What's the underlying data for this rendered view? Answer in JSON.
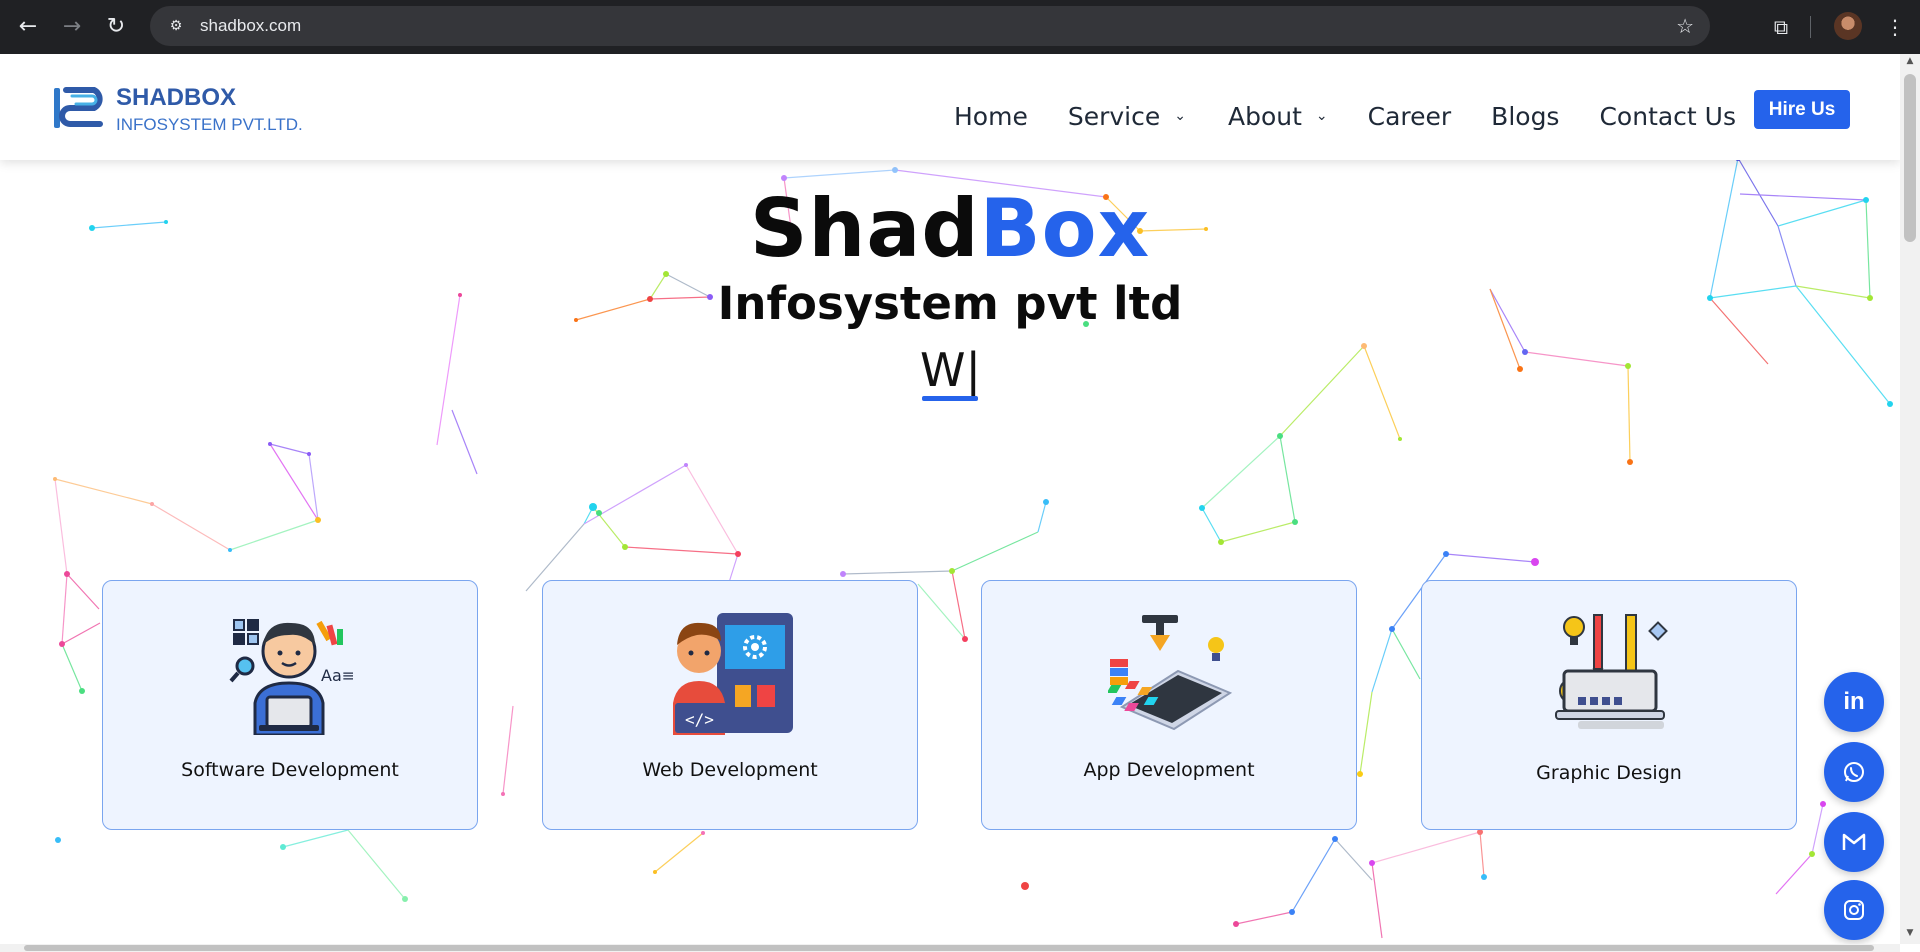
{
  "browser": {
    "url": "shadbox.com",
    "back_icon": "arrow-left-icon",
    "forward_icon": "arrow-right-icon",
    "reload_icon": "reload-icon",
    "bookmark_icon": "star-icon"
  },
  "header": {
    "logo_name": "SHADBOX",
    "logo_subtitle": "INFOSYSTEM PVT.LTD.",
    "nav": [
      {
        "label": "Home"
      },
      {
        "label": "Service"
      },
      {
        "label": "About"
      },
      {
        "label": "Career"
      },
      {
        "label": "Blogs"
      },
      {
        "label": "Contact Us"
      }
    ],
    "cta_label": "Hire Us"
  },
  "hero": {
    "title_main": "Shad",
    "title_accent": "Box",
    "subtitle": "Infosystem pvt ltd",
    "typed_text": "W|"
  },
  "services": [
    {
      "label": "Software Development",
      "icon": "developer-laptop-icon"
    },
    {
      "label": "Web Development",
      "icon": "web-dev-icon"
    },
    {
      "label": "App Development",
      "icon": "mobile-app-icon"
    },
    {
      "label": "Graphic Design",
      "icon": "design-tools-icon"
    }
  ],
  "social": [
    {
      "label": "in",
      "icon": "linkedin-icon"
    },
    {
      "label": "",
      "icon": "whatsapp-icon"
    },
    {
      "label": "",
      "icon": "gmail-icon"
    },
    {
      "label": "",
      "icon": "instagram-icon"
    }
  ],
  "colors": {
    "accent": "#2563eb",
    "card_bg": "#eef4ff",
    "card_border": "#7aa5ef",
    "browser_bar": "#202124"
  }
}
